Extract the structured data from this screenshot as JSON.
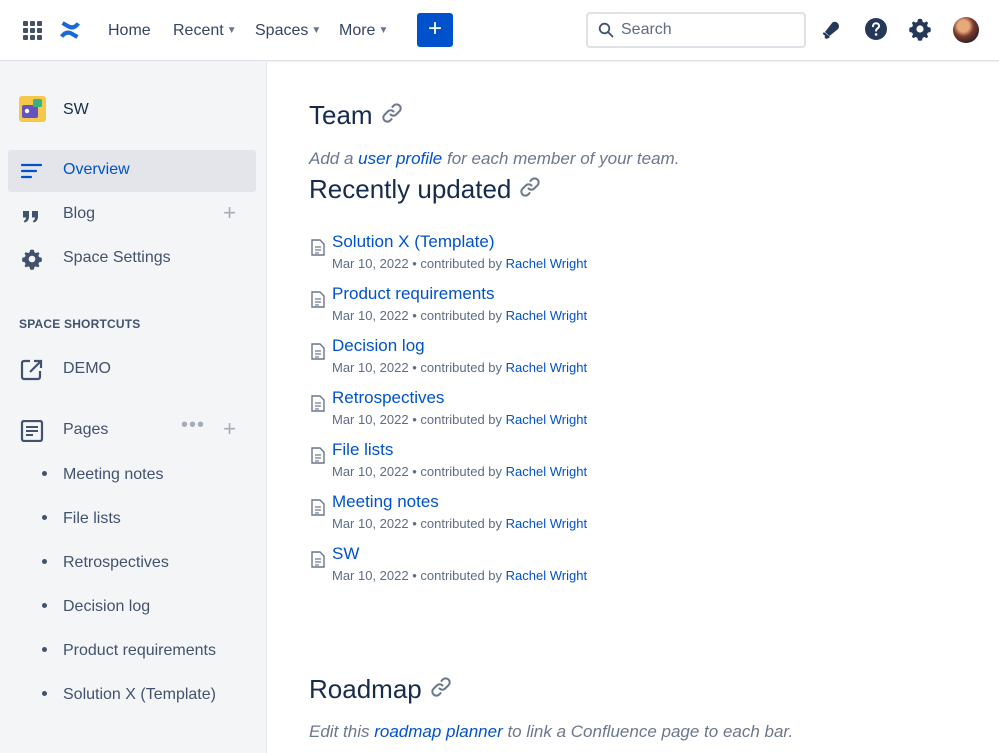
{
  "nav": {
    "items": [
      {
        "label": "Home",
        "has_dropdown": false
      },
      {
        "label": "Recent",
        "has_dropdown": true
      },
      {
        "label": "Spaces",
        "has_dropdown": true
      },
      {
        "label": "More",
        "has_dropdown": true
      }
    ],
    "create_label": "+",
    "search_placeholder": "Search",
    "icons": [
      "app-switcher-icon",
      "confluence-logo-icon",
      "notifications-icon",
      "help-icon",
      "settings-icon",
      "avatar"
    ]
  },
  "sidebar": {
    "space_name": "SW",
    "items": [
      {
        "label": "Overview",
        "icon": "overview-icon",
        "active": true
      },
      {
        "label": "Blog",
        "icon": "quote-icon",
        "active": false,
        "add": "+"
      },
      {
        "label": "Space Settings",
        "icon": "gear-icon",
        "active": false
      }
    ],
    "shortcuts_title": "SPACE SHORTCUTS",
    "shortcuts": [
      {
        "label": "DEMO",
        "icon": "external-link-icon"
      }
    ],
    "pages_label": "Pages",
    "pages_more": "•••",
    "pages_add": "+",
    "pages": [
      "Meeting notes",
      "File lists",
      "Retrospectives",
      "Decision log",
      "Product requirements",
      "Solution X (Template)"
    ]
  },
  "main": {
    "team": {
      "heading": "Team",
      "hint_prefix": "Add a ",
      "hint_link": "user profile",
      "hint_suffix": " for each member of your team."
    },
    "recently_updated": {
      "heading": "Recently updated",
      "items": [
        {
          "title": "Solution X (Template)",
          "meta": "Mar 10, 2022 • contributed by ",
          "author": "Rachel Wright"
        },
        {
          "title": "Product requirements",
          "meta": "Mar 10, 2022 • contributed by ",
          "author": "Rachel Wright"
        },
        {
          "title": "Decision log",
          "meta": "Mar 10, 2022 • contributed by ",
          "author": "Rachel Wright"
        },
        {
          "title": "Retrospectives",
          "meta": "Mar 10, 2022 • contributed by ",
          "author": "Rachel Wright"
        },
        {
          "title": "File lists",
          "meta": "Mar 10, 2022 • contributed by ",
          "author": "Rachel Wright"
        },
        {
          "title": "Meeting notes",
          "meta": "Mar 10, 2022 • contributed by ",
          "author": "Rachel Wright"
        },
        {
          "title": "SW",
          "meta": "Mar 10, 2022 • contributed by ",
          "author": "Rachel Wright"
        }
      ]
    },
    "roadmap": {
      "heading": "Roadmap",
      "hint_prefix": "Edit this ",
      "hint_link": "roadmap planner",
      "hint_suffix": " to link a Confluence page to each bar."
    }
  },
  "colors": {
    "brand": "#0052cc",
    "text": "#172b4d",
    "sidebar_bg": "#f4f5f7",
    "muted": "#6b778c"
  }
}
